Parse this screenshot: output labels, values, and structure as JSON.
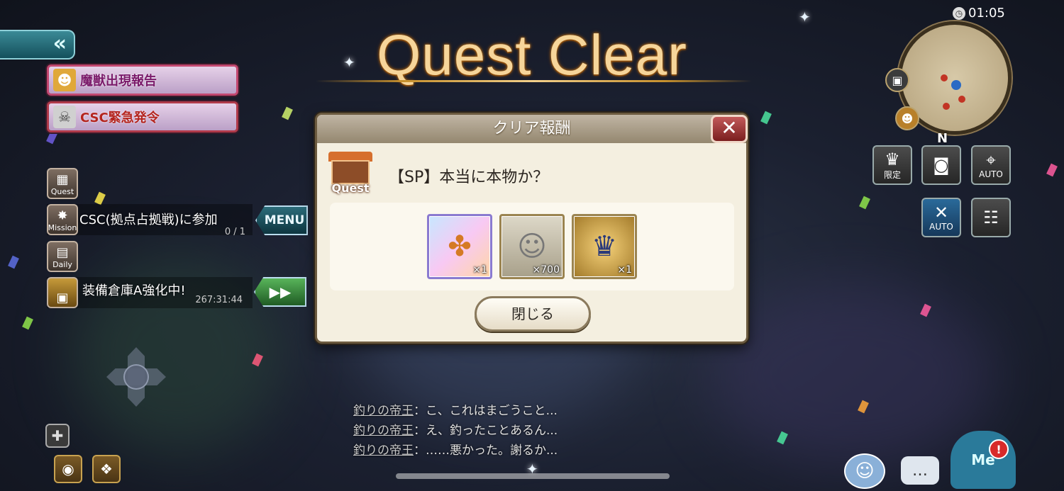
{
  "title": "Quest Clear",
  "timer": "01:05",
  "minimap": {
    "north_label": "N"
  },
  "banners": [
    {
      "icon": "fox-mask-icon",
      "label": "魔獣出現報告"
    },
    {
      "icon": "skull-crest-icon",
      "label": "CSC緊急発令"
    }
  ],
  "side_menu": {
    "quest": "Quest",
    "mission": "Mission",
    "daily": "Daily",
    "mission_text": "CSC(拠点占拠戦)に参加",
    "mission_progress": "0 / 1",
    "warehouse_text": "装備倉庫A強化中!",
    "warehouse_timer": "267:31:44",
    "menu_button": "MENU",
    "fast_forward": "▶▶"
  },
  "right_buttons": [
    {
      "icon": "hat-icon",
      "label": "限定"
    },
    {
      "icon": "camera-icon",
      "label": ""
    },
    {
      "icon": "auto-target-icon",
      "label": "AUTO"
    },
    {
      "icon": "auto-battle-icon",
      "label": "AUTO"
    },
    {
      "icon": "party-icon",
      "label": ""
    }
  ],
  "dialog": {
    "header": "クリア報酬",
    "quest_badge": "Quest",
    "quest_name": "【SP】本当に本物か？",
    "rewards": [
      {
        "icon": "spinner-icon",
        "qty": "×1"
      },
      {
        "icon": "character-silhouette-icon",
        "qty": "×700"
      },
      {
        "icon": "emblem-icon",
        "qty": "×1"
      }
    ],
    "close_button": "閉じる"
  },
  "chat": [
    {
      "who": "釣りの帝王",
      "text": "：こ、これはまごうこと..."
    },
    {
      "who": "釣りの帝王",
      "text": "：え、釣ったことあるん..."
    },
    {
      "who": "釣りの帝王",
      "text": "：……悪かった。謝るか..."
    }
  ],
  "bottom_right": {
    "me_label": "Me"
  },
  "colors": {
    "accent_gold": "#f6d59a",
    "dialog_bg": "#f4efe0",
    "close_red": "#c35a5a"
  }
}
